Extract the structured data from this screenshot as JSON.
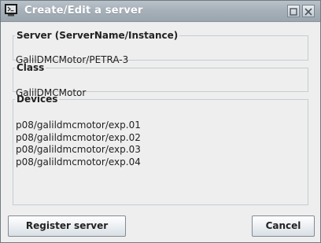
{
  "window": {
    "title": "Create/Edit a server",
    "icon": "terminal-app-icon",
    "controls": [
      "maximize-icon",
      "close-icon"
    ]
  },
  "server_group": {
    "label": "Server  (ServerName/Instance)",
    "value": "GalilDMCMotor/PETRA-3"
  },
  "class_group": {
    "label": "Class",
    "value": "GalilDMCMotor"
  },
  "devices_group": {
    "label": "Devices",
    "items": [
      "p08/galildmcmotor/exp.01",
      "p08/galildmcmotor/exp.02",
      "p08/galildmcmotor/exp.03",
      "p08/galildmcmotor/exp.04"
    ]
  },
  "buttons": {
    "register_label": "Register server",
    "cancel_label": "Cancel"
  }
}
